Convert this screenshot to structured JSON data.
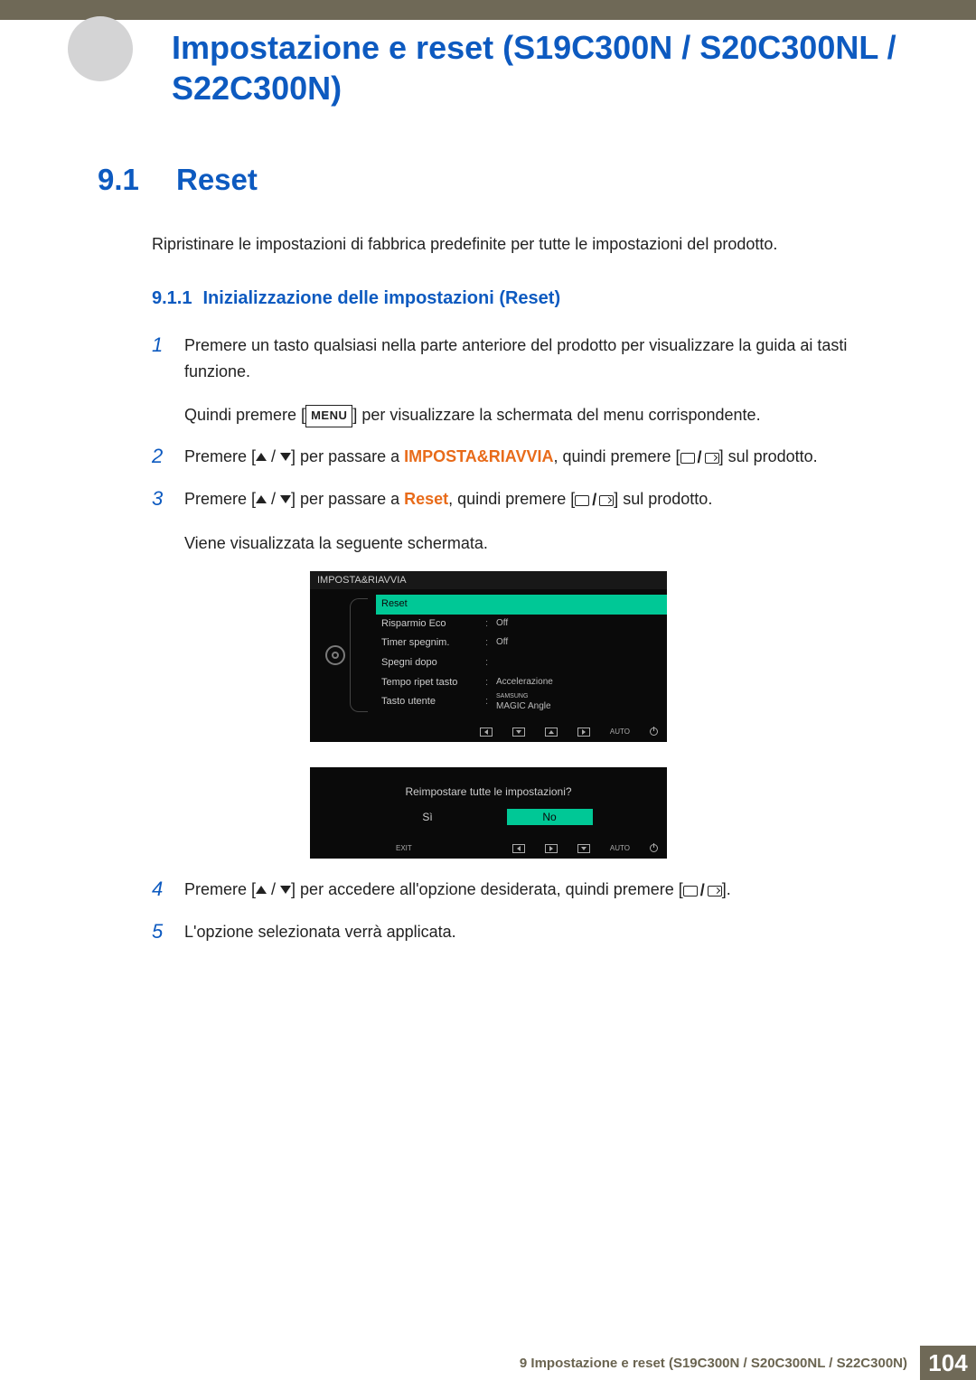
{
  "page_title": "Impostazione e reset (S19C300N / S20C300NL / S22C300N)",
  "section": {
    "number": "9.1",
    "title": "Reset",
    "description": "Ripristinare le impostazioni di fabbrica predefinite per tutte le impostazioni del prodotto."
  },
  "subsection": {
    "number": "9.1.1",
    "title": "Inizializzazione delle impostazioni (Reset)"
  },
  "steps": {
    "s1": {
      "num": "1",
      "text_a": "Premere un tasto qualsiasi nella parte anteriore del prodotto per visualizzare la guida ai tasti funzione.",
      "text_b_pre": "Quindi premere [",
      "menu_label": "MENU",
      "text_b_post": "] per visualizzare la schermata del menu corrispondente."
    },
    "s2": {
      "num": "2",
      "pre": "Premere [",
      "mid1": "] per passare a ",
      "target": "IMPOSTA&RIAVVIA",
      "mid2": ", quindi premere [",
      "post": "] sul prodotto."
    },
    "s3": {
      "num": "3",
      "pre": "Premere [",
      "mid1": "] per passare a ",
      "target": "Reset",
      "mid2": ", quindi premere [",
      "post": "] sul prodotto.",
      "after": "Viene visualizzata la seguente schermata."
    },
    "s4": {
      "num": "4",
      "pre": "Premere [",
      "mid": "] per accedere all'opzione desiderata, quindi premere [",
      "post": "]."
    },
    "s5": {
      "num": "5",
      "text": "L'opzione selezionata verrà applicata."
    }
  },
  "osd1": {
    "title": "IMPOSTA&RIAVVIA",
    "rows": [
      {
        "k": "Reset",
        "c": "",
        "v": "",
        "sel": true
      },
      {
        "k": "Risparmio Eco",
        "c": ":",
        "v": "Off",
        "sel": false
      },
      {
        "k": "Timer spegnim.",
        "c": ":",
        "v": "Off",
        "sel": false
      },
      {
        "k": "Spegni dopo",
        "c": ":",
        "v": "",
        "sel": false
      },
      {
        "k": "Tempo ripet tasto",
        "c": ":",
        "v": "Accelerazione",
        "sel": false
      },
      {
        "k": "Tasto utente",
        "c": ":",
        "v": "MAGIC Angle",
        "vsup": "SAMSUNG",
        "sel": false
      }
    ],
    "auto": "AUTO"
  },
  "osd2": {
    "question": "Reimpostare tutte le impostazioni?",
    "yes": "Sì",
    "no": "No",
    "exit": "EXIT",
    "auto": "AUTO"
  },
  "footer": {
    "chapter": "9 Impostazione e reset (S19C300N / S20C300NL / S22C300N)",
    "page": "104"
  },
  "tri_sep": " / "
}
